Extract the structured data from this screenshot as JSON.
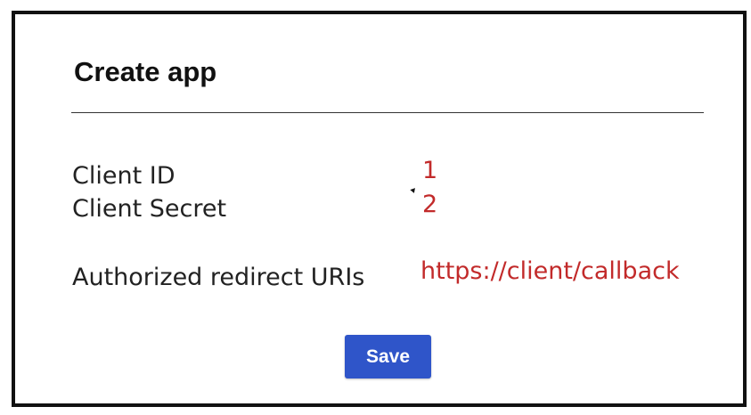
{
  "dialog": {
    "title": "Create app"
  },
  "fields": {
    "client_id": {
      "label": "Client ID",
      "value": "1"
    },
    "client_secret": {
      "label": "Client Secret",
      "value": "2"
    },
    "redirect_uris": {
      "label": "Authorized redirect URIs",
      "value": "https://client/callback"
    }
  },
  "actions": {
    "save_label": "Save"
  },
  "colors": {
    "value_text": "#c22a2a",
    "button_bg": "#2f55c9",
    "border": "#111111"
  }
}
